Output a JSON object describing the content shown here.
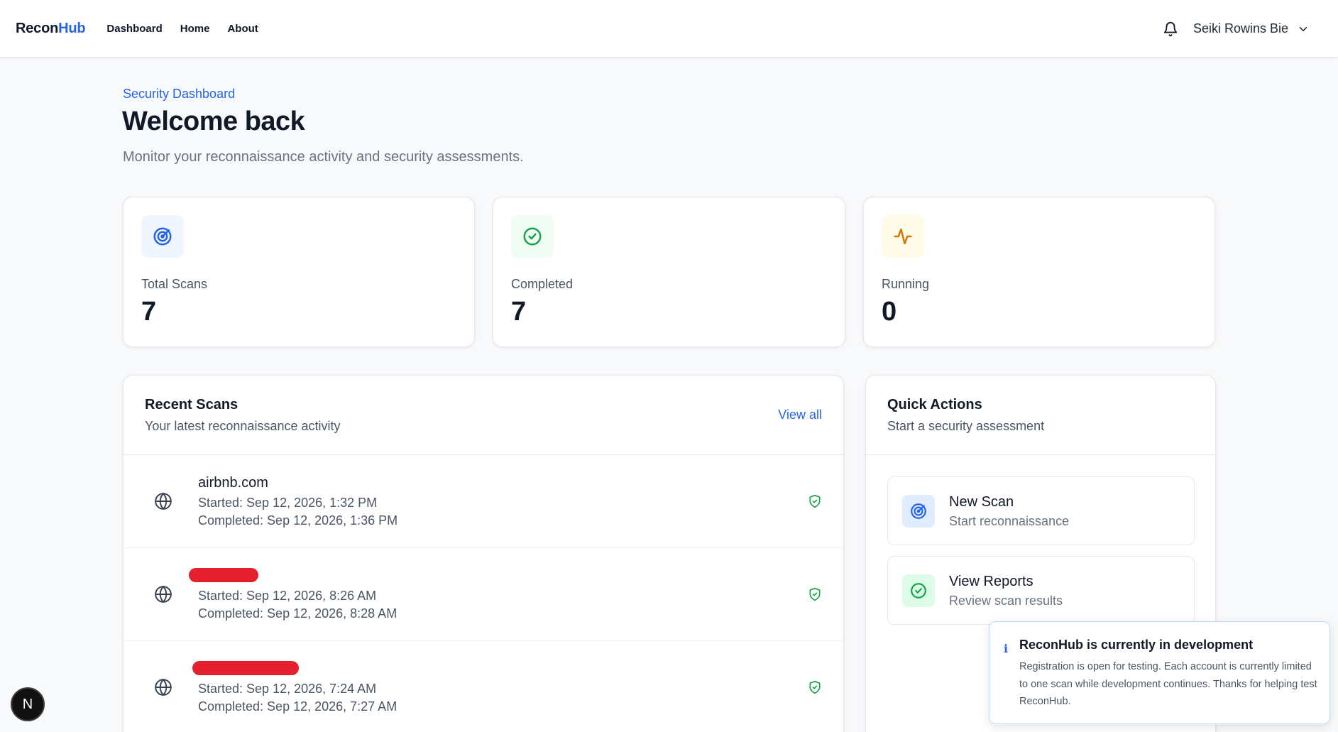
{
  "brand": {
    "part1": "Recon",
    "part2": "Hub"
  },
  "nav": {
    "items": [
      "Dashboard",
      "Home",
      "About"
    ]
  },
  "user": {
    "name": "Seiki Rowins Bie"
  },
  "header": {
    "eyebrow": "Security Dashboard",
    "title": "Welcome back",
    "subtitle": "Monitor your reconnaissance activity and security assessments."
  },
  "stats": [
    {
      "label": "Total Scans",
      "value": "7",
      "icon": "radar-icon"
    },
    {
      "label": "Completed",
      "value": "7",
      "icon": "check-circle-icon"
    },
    {
      "label": "Running",
      "value": "0",
      "icon": "activity-icon"
    }
  ],
  "recent": {
    "title": "Recent Scans",
    "subtitle": "Your latest reconnaissance activity",
    "view_all": "View all",
    "rows": [
      {
        "domain": "airbnb.com",
        "started": "Started: Sep 12, 2026, 1:32 PM",
        "completed": "Completed: Sep 12, 2026, 1:36 PM",
        "redacted": false
      },
      {
        "domain": "",
        "started": "Started: Sep 12, 2026, 8:26 AM",
        "completed": "Completed: Sep 12, 2026, 8:28 AM",
        "redacted": true
      },
      {
        "domain": "",
        "started": "Started: Sep 12, 2026, 7:24 AM",
        "completed": "Completed: Sep 12, 2026, 7:27 AM",
        "redacted": true
      }
    ]
  },
  "quick": {
    "title": "Quick Actions",
    "subtitle": "Start a security assessment",
    "actions": [
      {
        "title": "New Scan",
        "subtitle": "Start reconnaissance"
      },
      {
        "title": "View Reports",
        "subtitle": "Review scan results"
      }
    ]
  },
  "toast": {
    "icon": "i",
    "title": "ReconHub is currently in development",
    "body": "Registration is open for testing. Each account is currently limited to one scan while development continues. Thanks for helping test ReconHub."
  },
  "badge": {
    "letter": "N"
  },
  "colors": {
    "accent": "#2563eb",
    "success": "#16a34a",
    "warning": "#d97706",
    "redaction": "#e5202e"
  }
}
